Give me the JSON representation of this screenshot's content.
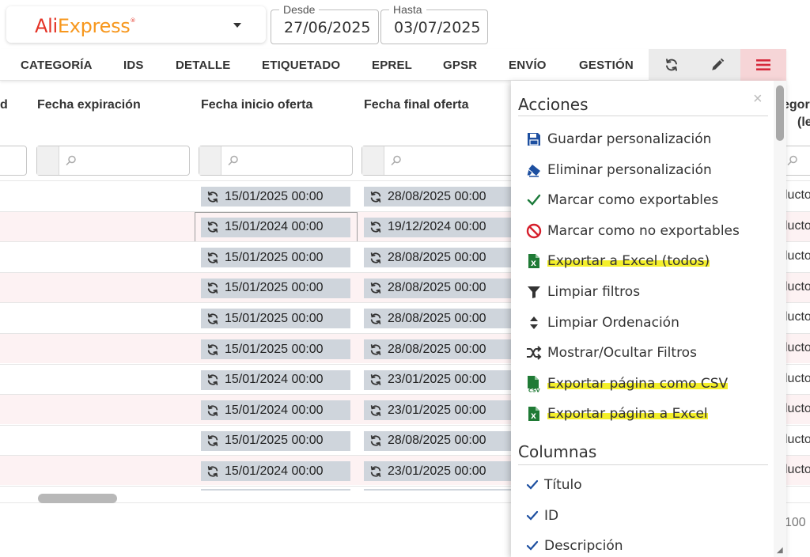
{
  "store": {
    "logo_main": "Ali",
    "logo_accent": "Express",
    "logo_mark": "®"
  },
  "dates": {
    "desde_label": "Desde",
    "desde_value": "27/06/2025",
    "hasta_label": "Hasta",
    "hasta_value": "03/07/2025"
  },
  "tabs": [
    "CATEGORÍA",
    "IDS",
    "DETALLE",
    "ETIQUETADO",
    "EPREL",
    "GPSR",
    "ENVÍO",
    "GESTIÓN"
  ],
  "grid": {
    "headers": {
      "partial_left": "d",
      "expiracion": "Fecha expiración",
      "inicio": "Fecha inicio oferta",
      "final": "Fecha final oferta",
      "partial_right_1": "egor",
      "partial_right_2": "(le"
    },
    "rows": [
      {
        "inicio": "15/01/2025 00:00",
        "final": "28/08/2025 00:00",
        "right": "lucto"
      },
      {
        "inicio": "15/01/2024 00:00",
        "final": "19/12/2024 00:00",
        "right": "lucto"
      },
      {
        "inicio": "15/01/2025 00:00",
        "final": "28/08/2025 00:00",
        "right": "lucto"
      },
      {
        "inicio": "15/01/2025 00:00",
        "final": "28/08/2025 00:00",
        "right": "lucto"
      },
      {
        "inicio": "15/01/2025 00:00",
        "final": "28/08/2025 00:00",
        "right": "lucto"
      },
      {
        "inicio": "15/01/2025 00:00",
        "final": "28/08/2025 00:00",
        "right": "lucto"
      },
      {
        "inicio": "15/01/2024 00:00",
        "final": "23/01/2025 00:00",
        "right": "lucto"
      },
      {
        "inicio": "15/01/2024 00:00",
        "final": "23/01/2025 00:00",
        "right": "lucto"
      },
      {
        "inicio": "15/01/2025 00:00",
        "final": "28/08/2025 00:00",
        "right": "lucto"
      },
      {
        "inicio": "15/01/2024 00:00",
        "final": "23/01/2025 00:00",
        "right": "lucto"
      }
    ],
    "pagination_partial": "100 "
  },
  "menu": {
    "acciones_title": "Acciones",
    "close": "×",
    "acciones": [
      {
        "label": "Guardar personalización",
        "icon": "save-icon",
        "highlight": false
      },
      {
        "label": "Eliminar personalización",
        "icon": "eraser-icon",
        "highlight": false
      },
      {
        "label": "Marcar como exportables",
        "icon": "check-icon",
        "highlight": false
      },
      {
        "label": "Marcar como no exportables",
        "icon": "ban-icon",
        "highlight": false
      },
      {
        "label": "Exportar a Excel (todos)",
        "icon": "excel-file-icon",
        "highlight": true
      },
      {
        "label": "Limpiar filtros",
        "icon": "filter-icon",
        "highlight": false
      },
      {
        "label": "Limpiar Ordenación",
        "icon": "sort-icon",
        "highlight": false
      },
      {
        "label": "Mostrar/Ocultar Filtros",
        "icon": "shuffle-icon",
        "highlight": false
      },
      {
        "label": "Exportar página como CSV",
        "icon": "csv-file-icon",
        "highlight": true
      },
      {
        "label": "Exportar página a Excel",
        "icon": "excel-file-icon",
        "highlight": true
      }
    ],
    "columnas_title": "Columnas",
    "columnas": [
      {
        "label": "Título",
        "checked": true
      },
      {
        "label": "ID",
        "checked": true
      },
      {
        "label": "Descripción",
        "checked": true
      }
    ]
  },
  "colors": {
    "accent_red": "#e43225",
    "accent_orange": "#f7971d",
    "highlight": "#f4ef2a",
    "menu_btn_bg": "#f6d5d7",
    "chip_bg": "#cfd5dc",
    "row_alt": "#fdf2f3"
  }
}
